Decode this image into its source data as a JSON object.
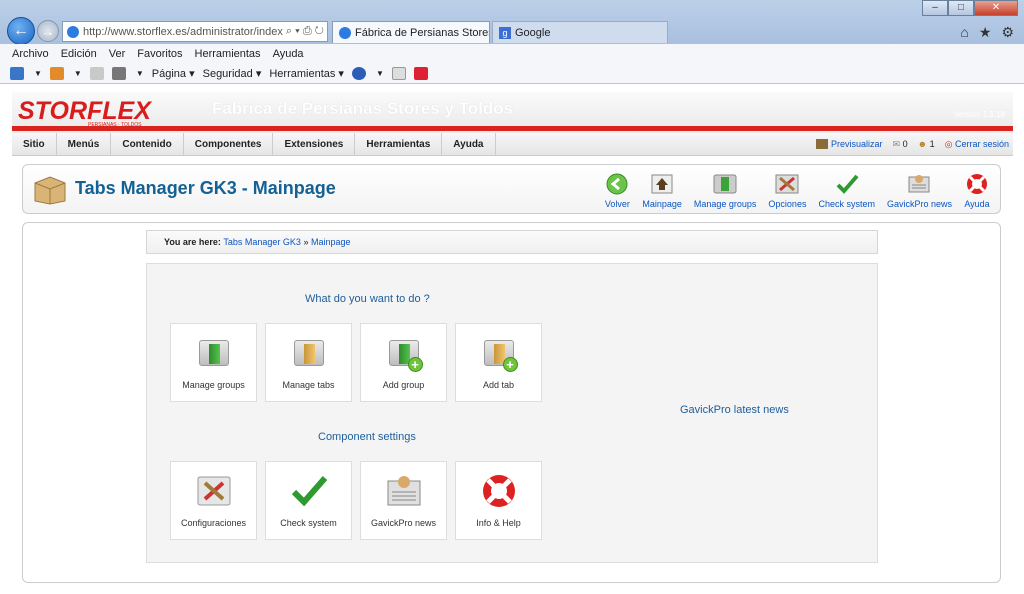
{
  "browser": {
    "address": "http://www.storflex.es/administrator/index",
    "address_domain": "storflex.es",
    "tabs": [
      {
        "label": "Fábrica de Persianas Stores ..."
      },
      {
        "label": "Google"
      }
    ],
    "menu": [
      "Archivo",
      "Edición",
      "Ver",
      "Favoritos",
      "Herramientas",
      "Ayuda"
    ],
    "commands": [
      "Página",
      "Seguridad",
      "Herramientas"
    ]
  },
  "site": {
    "logo": "STORFLEX",
    "logo_sub": "PERSIANAS · TOLDOS",
    "title": "Fábrica de Persianas Stores y Toldos",
    "version": "Versión 1.5.18"
  },
  "topmenu": {
    "items": [
      "Sitio",
      "Menús",
      "Contenido",
      "Componentes",
      "Extensiones",
      "Herramientas",
      "Ayuda"
    ],
    "preview": "Previsualizar",
    "messages": "0",
    "users": "1",
    "logout": "Cerrar sesión"
  },
  "toolbar": {
    "title": "Tabs Manager GK3 - Mainpage",
    "buttons": [
      "Volver",
      "Mainpage",
      "Manage groups",
      "Opciones",
      "Check system",
      "GavickPro news",
      "Ayuda"
    ]
  },
  "breadcrumb": {
    "prefix": "You are here:",
    "link1": "Tabs Manager GK3",
    "sep": "»",
    "link2": "Mainpage"
  },
  "main": {
    "section1": "What do you want to do ?",
    "cards1": [
      "Manage groups",
      "Manage tabs",
      "Add group",
      "Add tab"
    ],
    "section2": "Component settings",
    "cards2": [
      "Configuraciones",
      "Check system",
      "GavickPro news",
      "Info & Help"
    ],
    "news_title": "GavickPro latest news"
  }
}
